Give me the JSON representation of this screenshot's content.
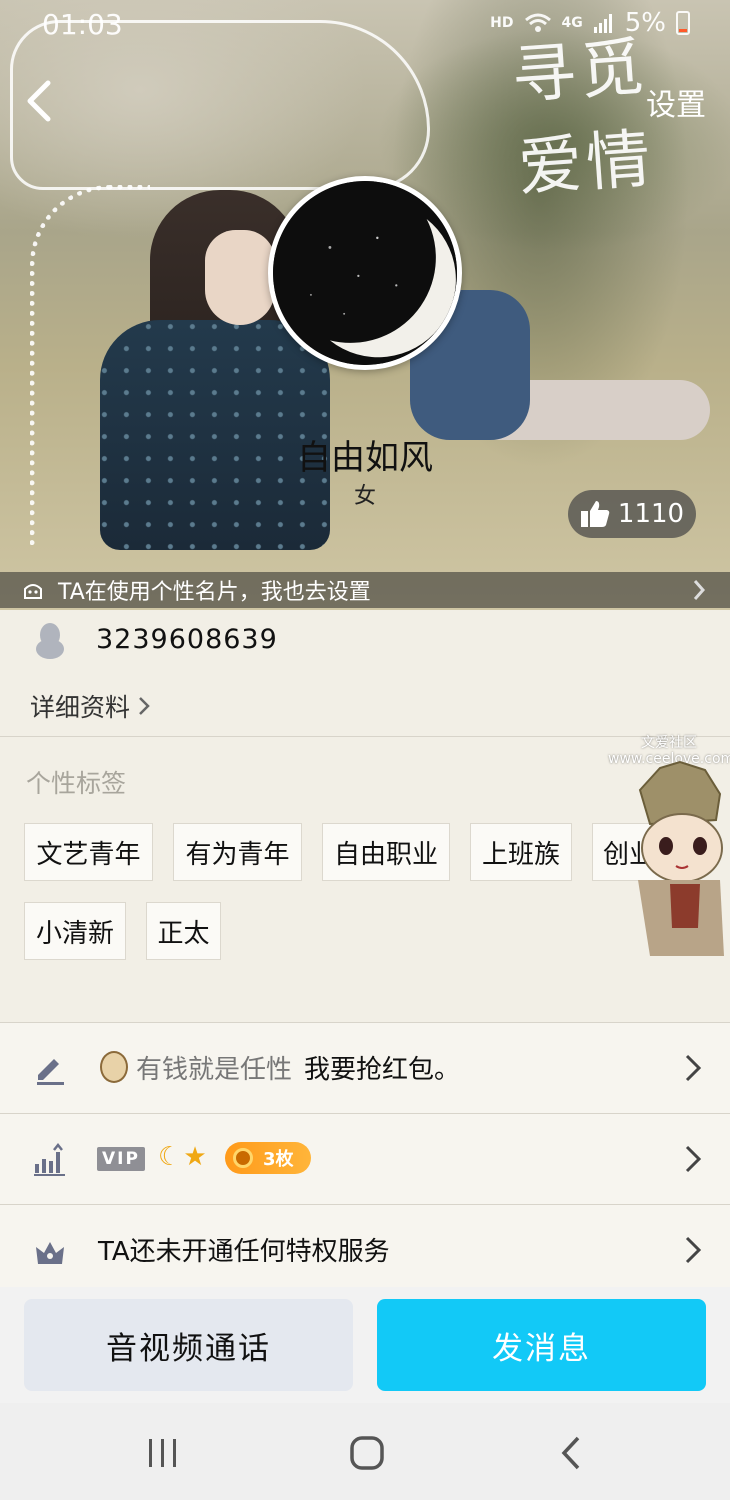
{
  "status_bar": {
    "time": "01:03",
    "hd": "HD",
    "network": "4G",
    "battery": "5%"
  },
  "header": {
    "back_icon": "chevron-left-icon",
    "settings_label": "设置",
    "cover_calligraphy": "寻觅爱情"
  },
  "profile": {
    "nickname": "自由如风",
    "gender": "女",
    "likes": "1110",
    "card_banner": "TA在使用个性名片，我也去设置",
    "qq_number": "3239608639",
    "detail_link": "详细资料"
  },
  "tags": {
    "title": "个性标签",
    "items": [
      "文艺青年",
      "有为青年",
      "自由职业",
      "上班族",
      "创业",
      "小清新",
      "正太"
    ]
  },
  "watermark": {
    "line1": "文爱社区",
    "line2": "www.ceelove.com"
  },
  "rows": {
    "signature_label": "有钱就是任性",
    "signature_text": "我要抢红包。",
    "vip": "VIP",
    "coins": "3枚",
    "privilege": "TA还未开通任何特权服务"
  },
  "actions": {
    "call": "音视频通话",
    "message": "发消息"
  },
  "colors": {
    "accent": "#12c9f7",
    "coin": "#ff9a1a",
    "vip_gray": "#8f8f95"
  }
}
